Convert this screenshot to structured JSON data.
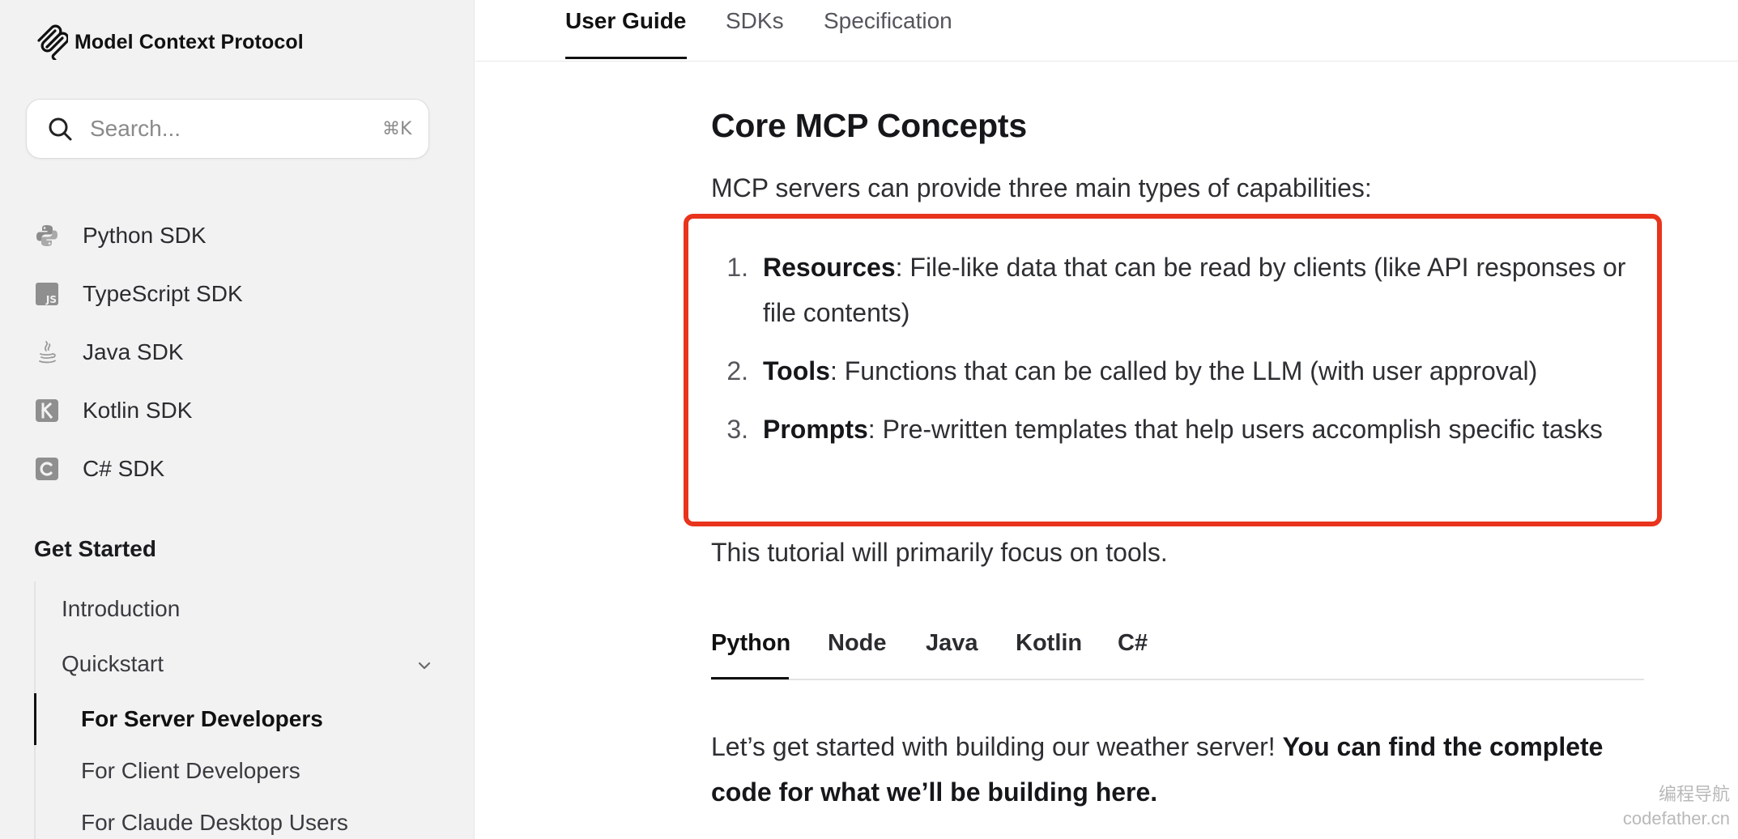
{
  "sidebar": {
    "brand": {
      "title": "Model Context Protocol",
      "logo_icon": "mcp-logo-icon"
    },
    "search": {
      "placeholder": "Search...",
      "shortcut": "⌘K"
    },
    "sdks": [
      {
        "label": "Python SDK",
        "icon": "python-icon"
      },
      {
        "label": "TypeScript SDK",
        "icon": "js-icon"
      },
      {
        "label": "Java SDK",
        "icon": "java-icon"
      },
      {
        "label": "Kotlin SDK",
        "icon": "kotlin-icon"
      },
      {
        "label": "C# SDK",
        "icon": "csharp-icon"
      }
    ],
    "section_title": "Get Started",
    "nav": {
      "introduction": "Introduction",
      "quickstart": "Quickstart",
      "server_developers": "For Server Developers",
      "client_developers": "For Client Developers",
      "claude_desktop_users": "For Claude Desktop Users"
    }
  },
  "topnav": {
    "tabs": [
      "User Guide",
      "SDKs",
      "Specification"
    ],
    "active": "User Guide"
  },
  "content": {
    "heading": "Core MCP Concepts",
    "intro": "MCP servers can provide three main types of capabilities:",
    "capabilities": [
      {
        "num": "1.",
        "term": "Resources",
        "desc": ": File-like data that can be read by clients (like API responses or file contents)"
      },
      {
        "num": "2.",
        "term": "Tools",
        "desc": ": Functions that can be called by the LLM (with user approval)"
      },
      {
        "num": "3.",
        "term": "Prompts",
        "desc": ": Pre-written templates that help users accomplish specific tasks"
      }
    ],
    "focus": "This tutorial will primarily focus on tools.",
    "lang_tabs": [
      "Python",
      "Node",
      "Java",
      "Kotlin",
      "C#"
    ],
    "lang_active": "Python",
    "closing_text": "Let’s get started with building our weather server! ",
    "closing_link": "You can find the complete code for what we’ll be building here."
  },
  "highlight_color": "#e8341c",
  "watermark": {
    "line1": "编程导航",
    "line2": "codefather.cn"
  }
}
